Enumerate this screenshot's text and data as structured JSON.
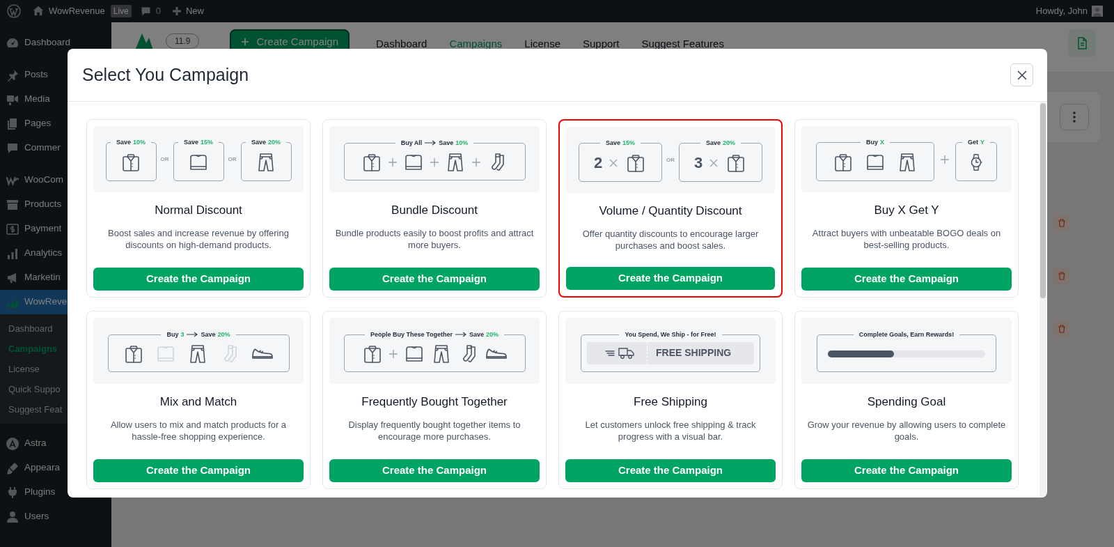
{
  "admin_bar": {
    "site": "WowRevenue",
    "badge": "Live",
    "comments": "0",
    "new": "New",
    "greeting": "Howdy, John"
  },
  "sidebar": {
    "groups": [
      [
        {
          "label": "Dashboard",
          "selected": false
        }
      ],
      [
        {
          "label": "Posts",
          "selected": false
        },
        {
          "label": "Media",
          "selected": false
        },
        {
          "label": "Pages",
          "selected": false
        },
        {
          "label": "Commer",
          "selected": false
        }
      ],
      [
        {
          "label": "WooCom",
          "selected": false
        },
        {
          "label": "Products",
          "selected": false
        },
        {
          "label": "Payment",
          "selected": false
        },
        {
          "label": "Analytics",
          "selected": false
        },
        {
          "label": "Marketin",
          "selected": false
        },
        {
          "label": "WowReve",
          "selected": true,
          "children": [
            {
              "label": "Dashboard",
              "selected": false
            },
            {
              "label": "Campaigns",
              "selected": true
            },
            {
              "label": "License",
              "selected": false
            },
            {
              "label": "Quick Suppo",
              "selected": false
            },
            {
              "label": "Suggest Feat",
              "selected": false
            }
          ]
        }
      ],
      [
        {
          "label": "Astra",
          "selected": false
        },
        {
          "label": "Appeara",
          "selected": false
        },
        {
          "label": "Plugins",
          "selected": false
        },
        {
          "label": "Users",
          "selected": false
        }
      ]
    ]
  },
  "page": {
    "version": "11.9",
    "create_button": "Create Campaign",
    "tabs": [
      {
        "label": "Dashboard",
        "selected": false
      },
      {
        "label": "Campaigns",
        "selected": true
      },
      {
        "label": "License",
        "selected": false
      },
      {
        "label": "Support",
        "selected": false
      },
      {
        "label": "Suggest Features",
        "selected": false
      }
    ]
  },
  "modal": {
    "title": "Select You Campaign",
    "cards": [
      {
        "title": "Normal Discount",
        "description": "Boost sales and increase revenue by offering discounts on high-demand products.",
        "button": "Create the Campaign",
        "selected": false,
        "illustration": {
          "kind": "options",
          "options": [
            {
              "text": "Save",
              "accent": "10%"
            },
            {
              "text": "Save",
              "accent": "15%"
            },
            {
              "text": "Save",
              "accent": "20%"
            }
          ],
          "separators": [
            "OR",
            "OR"
          ]
        }
      },
      {
        "title": "Bundle Discount",
        "description": "Bundle products easily to boost profits and attract more buyers.",
        "button": "Create the Campaign",
        "selected": false,
        "illustration": {
          "kind": "bundle",
          "caption": [
            {
              "text": "Buy All"
            },
            {
              "text": "Save",
              "accent": "10%"
            }
          ]
        }
      },
      {
        "title": "Volume / Quantity Discount",
        "description": "Offer quantity discounts to encourage larger purchases and boost sales.",
        "button": "Create the Campaign",
        "selected": true,
        "illustration": {
          "kind": "volume",
          "options": [
            {
              "text": "Save",
              "accent": "15%",
              "quantity": "2"
            },
            {
              "text": "Save",
              "accent": "20%",
              "quantity": "3"
            }
          ],
          "separators": [
            "OR"
          ]
        }
      },
      {
        "title": "Buy X Get Y",
        "description": "Attract buyers with unbeatable BOGO deals on best-selling products.",
        "button": "Create the Campaign",
        "selected": false,
        "illustration": {
          "kind": "buy_get",
          "options": [
            {
              "text": "Buy",
              "accent": "X"
            },
            {
              "text": "Get",
              "accent": "Y"
            }
          ]
        }
      },
      {
        "title": "Mix and Match",
        "description": "Allow users to mix and match products for a hassle-free shopping experience.",
        "button": "Create the Campaign",
        "selected": false,
        "illustration": {
          "kind": "mix",
          "caption": [
            {
              "text": "Buy",
              "accent": "3"
            },
            {
              "text": "Save",
              "accent": "20%"
            }
          ],
          "items": [
            {
              "selected": true
            },
            {
              "selected": false
            },
            {
              "selected": true
            },
            {
              "selected": false
            },
            {
              "selected": true
            }
          ]
        }
      },
      {
        "title": "Frequently Bought Together",
        "description": "Display frequently bought together items to encourage more purchases.",
        "button": "Create the Campaign",
        "selected": false,
        "illustration": {
          "kind": "together",
          "caption": [
            {
              "text": "People Buy These Together"
            },
            {
              "text": "Save",
              "accent": "20%"
            }
          ]
        }
      },
      {
        "title": "Free Shipping",
        "description": "Let customers unlock free shipping & track progress with a visual bar.",
        "button": "Create the Campaign",
        "selected": false,
        "illustration": {
          "kind": "shipping",
          "caption": [
            {
              "text": "You Spend, We Ship - for Free!"
            }
          ],
          "banner": "FREE SHIPPING"
        }
      },
      {
        "title": "Spending Goal",
        "description": "Grow your revenue by allowing users to complete goals.",
        "button": "Create the Campaign",
        "selected": false,
        "illustration": {
          "kind": "goal",
          "caption": [
            {
              "text": "Complete Goals, Earn Rewards!"
            }
          ],
          "level": 0.42
        }
      }
    ]
  }
}
